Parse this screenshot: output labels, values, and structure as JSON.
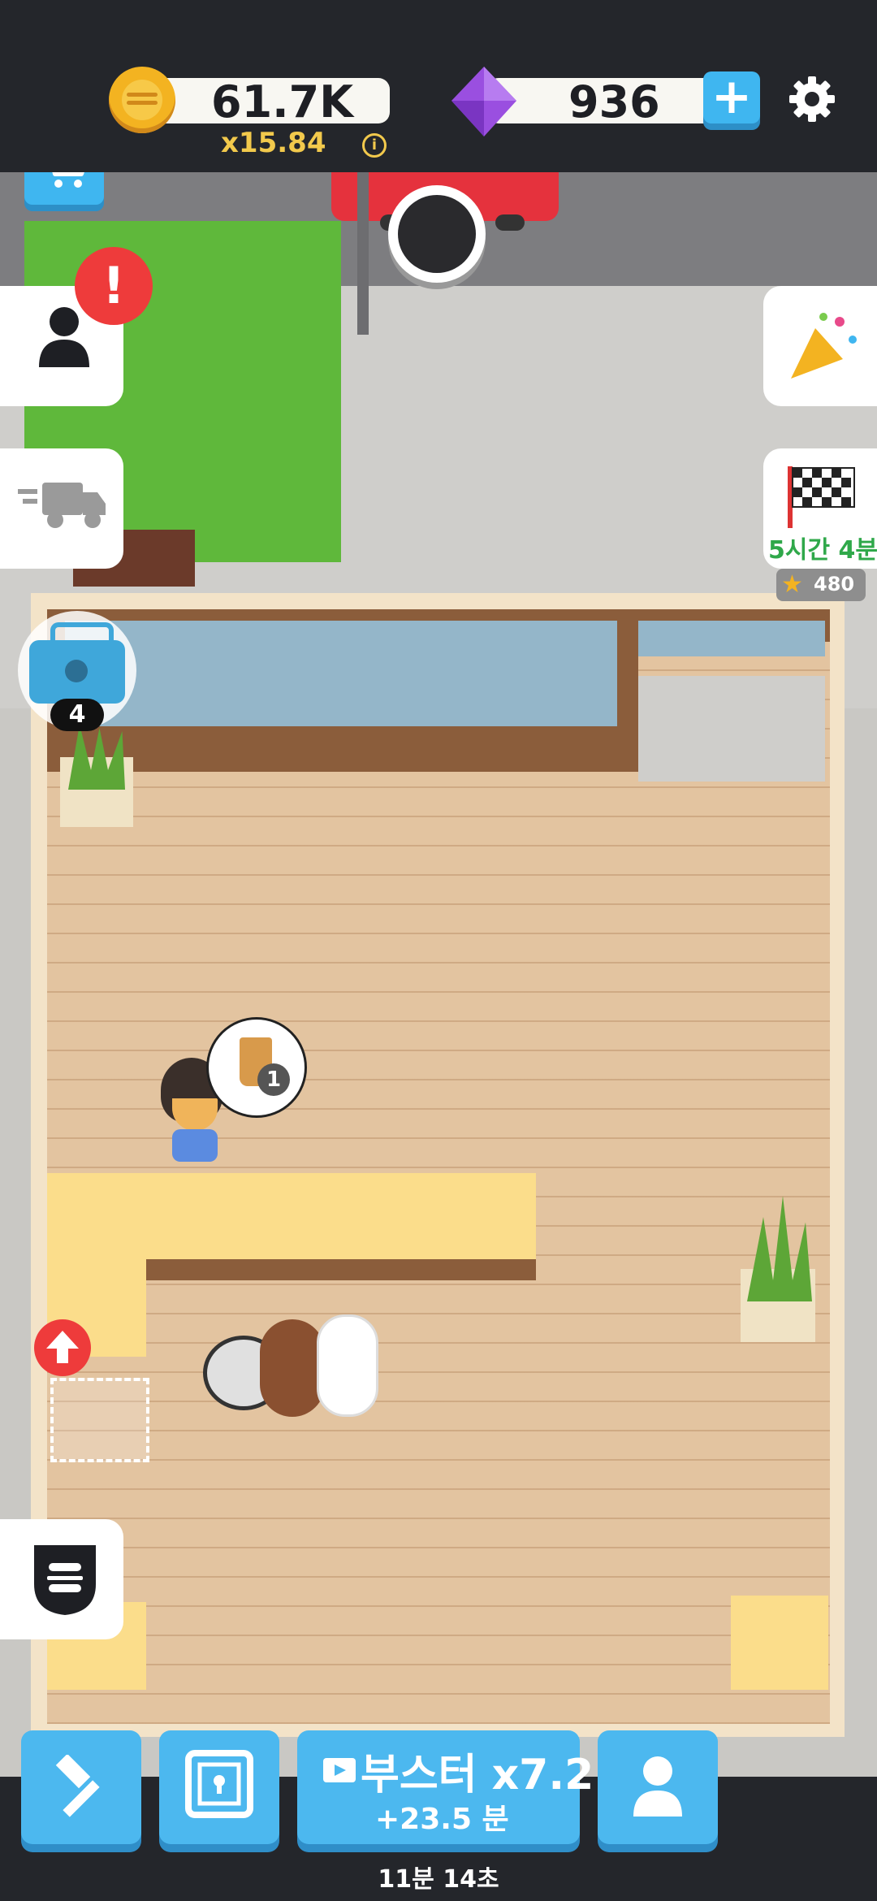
{
  "hud": {
    "coins": "61.7K",
    "multiplier": "x15.84",
    "info_icon": "i",
    "gems": "936",
    "plus": "+"
  },
  "side_left": {
    "alert": "!"
  },
  "side_right": {
    "event_timer": "5시간 4분",
    "event_stars": "480"
  },
  "toolbox": {
    "count": "4"
  },
  "customer_order": {
    "count": "1"
  },
  "bottom": {
    "booster_label": "부스터",
    "booster_multiplier": "x7.2",
    "booster_extra": "+23.5 분",
    "timer": "11분 14초"
  },
  "colors": {
    "accent_blue": "#3fb6f0",
    "coin_gold": "#f3b321",
    "gem_purple": "#9a4fe0",
    "alert_red": "#ee3b3b",
    "timer_green": "#2fa84a",
    "floor": "#e3c4a0"
  }
}
